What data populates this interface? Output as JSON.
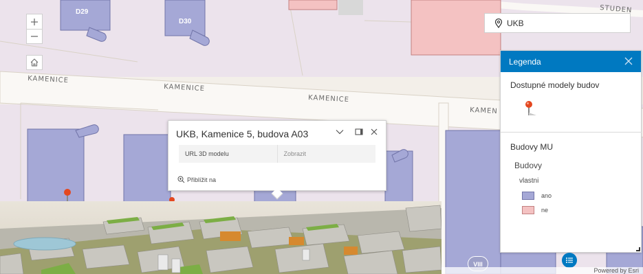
{
  "map": {
    "street_labels": [
      "KAMENICE",
      "KAMENICE",
      "KAMENICE",
      "KAMEN",
      "STUDEN"
    ],
    "building_labels": [
      "D29",
      "D30"
    ],
    "bottom_building_label": "VIII",
    "colors": {
      "background": "#f3efe9",
      "campus_area": "#ece3ec",
      "street": "#faf8f5",
      "street_edge": "#d9d2c6",
      "owned_building": "#a5a8d6",
      "owned_building_stroke": "#7174a8",
      "not_owned_building": "#f4c2c2",
      "not_owned_building_stroke": "#c28080",
      "gray_building": "#d8d8d8"
    }
  },
  "controls": {
    "zoom_in_icon": "plus-icon",
    "zoom_out_icon": "minus-icon",
    "home_icon": "home-icon"
  },
  "search": {
    "icon": "location-pin-icon",
    "value": "UKB"
  },
  "legend": {
    "title": "Legenda",
    "section1_title": "Dostupné modely budov",
    "section1_icon": "map-pin-icon",
    "section2_title": "Budovy MU",
    "layer_name": "Budovy",
    "field_name": "vlastni",
    "items": [
      {
        "label": "ano",
        "color": "#a5a8d6"
      },
      {
        "label": "ne",
        "color": "#f4c2c2"
      }
    ]
  },
  "popup": {
    "title": "UKB, Kamenice 5, budova A03",
    "field_label": "URL 3D modelu",
    "field_value": "Zobrazit",
    "zoom_label": "Přiblížit na"
  },
  "attribution": "Powered by Esri",
  "accent_color": "#0079c1"
}
